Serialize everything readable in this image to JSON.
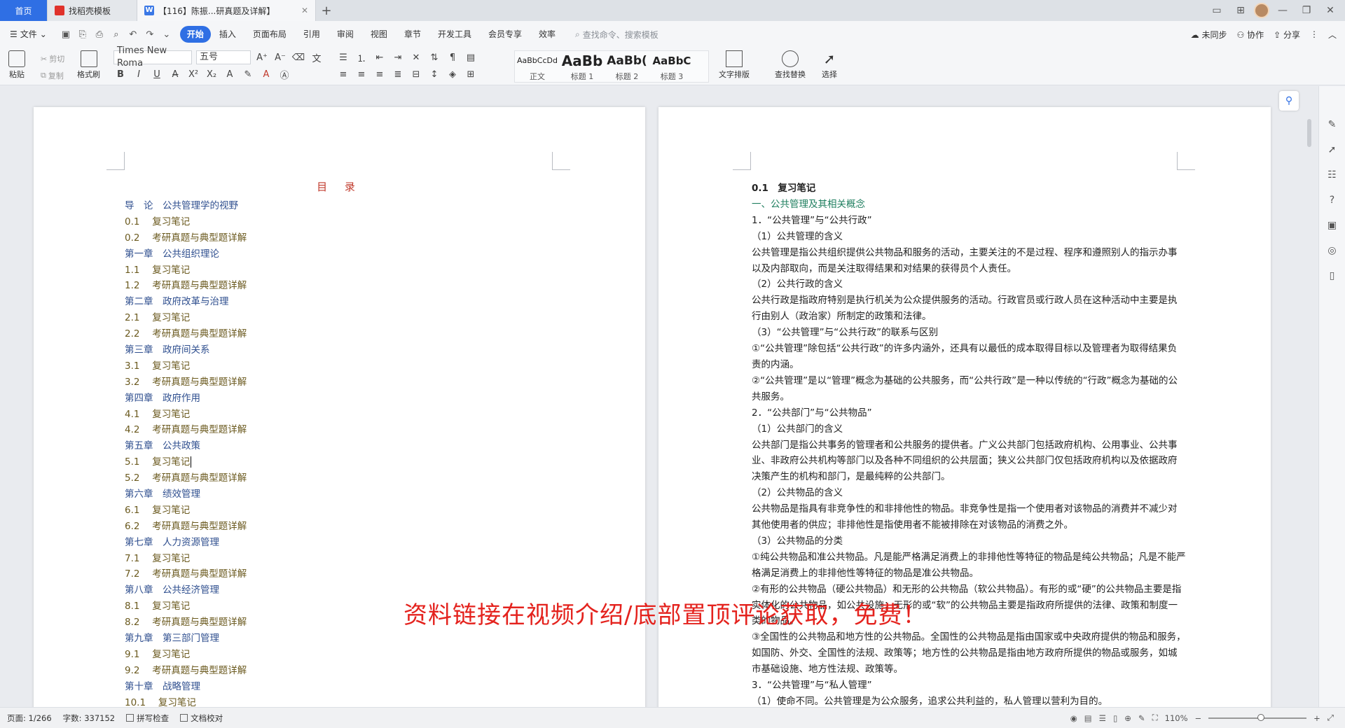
{
  "titlebar": {
    "tabs": [
      {
        "label": "首页"
      },
      {
        "label": "找稻壳模板"
      },
      {
        "label": "【116】陈振...研真题及详解】"
      }
    ],
    "new_tab": "+"
  },
  "menubar": {
    "file": "文件",
    "items": [
      "开始",
      "插入",
      "页面布局",
      "引用",
      "审阅",
      "视图",
      "章节",
      "开发工具",
      "会员专享",
      "效率"
    ],
    "search_placeholder": "查找命令、搜索模板",
    "right": {
      "sync": "未同步",
      "collab": "协作",
      "share": "分享"
    }
  },
  "ribbon": {
    "paste": "粘贴",
    "cut": "剪切",
    "copy": "复制",
    "format_painter": "格式刷",
    "font_name": "Times New Roma",
    "font_size": "五号",
    "styles": [
      {
        "sample": "AaBbCcDd",
        "label": "正文"
      },
      {
        "sample": "AaBb",
        "label": "标题 1"
      },
      {
        "sample": "AaBb(",
        "label": "标题 2"
      },
      {
        "sample": "AaBbC",
        "label": "标题 3"
      }
    ],
    "text_layout": "文字排版",
    "find_replace": "查找替换",
    "select": "选择"
  },
  "toc": {
    "title": "目 录",
    "lines": [
      {
        "text": "导　论　公共管理学的视野",
        "kind": "chapter"
      },
      {
        "text": "0.1　 复习笔记",
        "kind": "sub"
      },
      {
        "text": "0.2　 考研真题与典型题详解",
        "kind": "sub"
      },
      {
        "text": "第一章　公共组织理论",
        "kind": "chapter"
      },
      {
        "text": "1.1　 复习笔记",
        "kind": "sub"
      },
      {
        "text": "1.2　 考研真题与典型题详解",
        "kind": "sub"
      },
      {
        "text": "第二章　政府改革与治理",
        "kind": "chapter"
      },
      {
        "text": "2.1　 复习笔记",
        "kind": "sub"
      },
      {
        "text": "2.2　 考研真题与典型题详解",
        "kind": "sub"
      },
      {
        "text": "第三章　政府间关系",
        "kind": "chapter"
      },
      {
        "text": "3.1　 复习笔记",
        "kind": "sub"
      },
      {
        "text": "3.2　 考研真题与典型题详解",
        "kind": "sub"
      },
      {
        "text": "第四章　政府作用",
        "kind": "chapter"
      },
      {
        "text": "4.1　 复习笔记",
        "kind": "sub"
      },
      {
        "text": "4.2　 考研真题与典型题详解",
        "kind": "sub"
      },
      {
        "text": "第五章　公共政策",
        "kind": "chapter"
      },
      {
        "text": "5.1　 复习笔记",
        "kind": "sub"
      },
      {
        "text": "5.2　 考研真题与典型题详解",
        "kind": "sub"
      },
      {
        "text": "第六章　绩效管理",
        "kind": "chapter"
      },
      {
        "text": "6.1　 复习笔记",
        "kind": "sub"
      },
      {
        "text": "6.2　 考研真题与典型题详解",
        "kind": "sub"
      },
      {
        "text": "第七章　人力资源管理",
        "kind": "chapter"
      },
      {
        "text": "7.1　 复习笔记",
        "kind": "sub"
      },
      {
        "text": "7.2　 考研真题与典型题详解",
        "kind": "sub"
      },
      {
        "text": "第八章　公共经济管理",
        "kind": "chapter"
      },
      {
        "text": "8.1　 复习笔记",
        "kind": "sub"
      },
      {
        "text": "8.2　 考研真题与典型题详解",
        "kind": "sub"
      },
      {
        "text": "第九章　第三部门管理",
        "kind": "chapter"
      },
      {
        "text": "9.1　 复习笔记",
        "kind": "sub"
      },
      {
        "text": "9.2　 考研真题与典型题详解",
        "kind": "sub"
      },
      {
        "text": "第十章　战略管理",
        "kind": "chapter"
      },
      {
        "text": "10.1　 复习笔记",
        "kind": "sub"
      }
    ]
  },
  "content": {
    "paragraphs": [
      {
        "text": "0.1　复习笔记",
        "kind": "h1"
      },
      {
        "text": "一、公共管理及其相关概念",
        "kind": "h2"
      },
      {
        "text": "1．“公共管理”与“公共行政”",
        "kind": "p"
      },
      {
        "text": "（1）公共管理的含义",
        "kind": "p"
      },
      {
        "text": "公共管理是指公共组织提供公共物品和服务的活动，主要关注的不是过程、程序和遵照别人的指示办事以及内部取向，而是关注取得结果和对结果的获得员个人责任。",
        "kind": "p"
      },
      {
        "text": "（2）公共行政的含义",
        "kind": "p"
      },
      {
        "text": "公共行政是指政府特别是执行机关为公众提供服务的活动。行政官员或行政人员在这种活动中主要是执行由别人（政治家）所制定的政策和法律。",
        "kind": "p"
      },
      {
        "text": "（3）“公共管理”与“公共行政”的联系与区别",
        "kind": "p"
      },
      {
        "text": "①“公共管理”除包括“公共行政”的许多内涵外，还具有以最低的成本取得目标以及管理者为取得结果负责的内涵。",
        "kind": "p"
      },
      {
        "text": "②“公共管理”是以“管理”概念为基础的公共服务，而“公共行政”是一种以传统的“行政”概念为基础的公共服务。",
        "kind": "p"
      },
      {
        "text": "2．“公共部门”与“公共物品”",
        "kind": "p"
      },
      {
        "text": "（1）公共部门的含义",
        "kind": "p"
      },
      {
        "text": "公共部门是指公共事务的管理者和公共服务的提供者。广义公共部门包括政府机构、公用事业、公共事业、非政府公共机构等部门以及各种不同组织的公共层面；狭义公共部门仅包括政府机构以及依据政府决策产生的机构和部门，是最纯粹的公共部门。",
        "kind": "p"
      },
      {
        "text": "（2）公共物品的含义",
        "kind": "p"
      },
      {
        "text": "公共物品是指具有非竞争性的和非排他性的物品。非竞争性是指一个使用者对该物品的消费并不减少对其他使用者的供应；非排他性是指使用者不能被排除在对该物品的消费之外。",
        "kind": "p"
      },
      {
        "text": "（3）公共物品的分类",
        "kind": "p"
      },
      {
        "text": "①纯公共物品和准公共物品。凡是能严格满足消费上的非排他性等特征的物品是纯公共物品；凡是不能严格满足消费上的非排他性等特征的物品是准公共物品。",
        "kind": "p"
      },
      {
        "text": "②有形的公共物品（硬公共物品）和无形的公共物品（软公共物品）。有形的或“硬”的公共物品主要是指实体化的公共物品，如公共设施；无形的或“软”的公共物品主要是指政府所提供的法律、政策和制度一类的物品。",
        "kind": "p"
      },
      {
        "text": "③全国性的公共物品和地方性的公共物品。全国性的公共物品是指由国家或中央政府提供的物品和服务，如国防、外交、全国性的法规、政策等；地方性的公共物品是指由地方政府所提供的物品或服务，如城市基础设施、地方性法规、政策等。",
        "kind": "p"
      },
      {
        "text": "3．“公共管理”与“私人管理”",
        "kind": "p"
      },
      {
        "text": "（1）使命不同。公共管理是为公众服务，追求公共利益的，私人管理以营利为目的。",
        "kind": "p"
      }
    ]
  },
  "overlay": {
    "text": "资料链接在视频介绍/底部置顶评论获取，免费！"
  },
  "statusbar": {
    "page": "页面: 1/266",
    "words": "字数: 337152",
    "spell": "拼写检查",
    "proof": "文档校对",
    "zoom": "110%"
  },
  "colors": {
    "accent": "#2f6fe4",
    "toc_title": "#c0392b",
    "overlay": "#e4221d"
  }
}
